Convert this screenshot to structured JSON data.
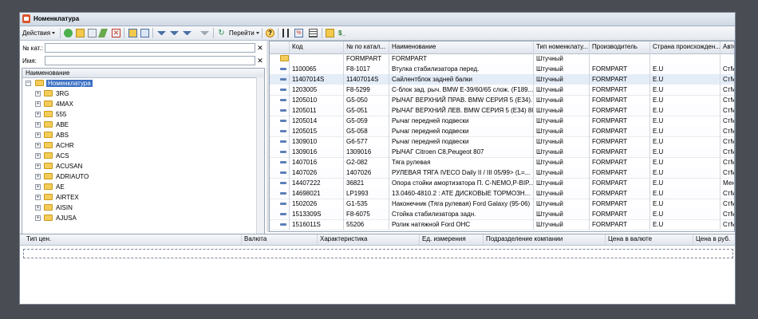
{
  "window": {
    "title": "Номенклатура"
  },
  "toolbar": {
    "actions_label": "Действия",
    "goto_label": "Перейти",
    "extra_label": "$_"
  },
  "filters": [
    {
      "label": "№ кат.:",
      "value": ""
    },
    {
      "label": "Имя:",
      "value": ""
    }
  ],
  "tree": {
    "header": "Наименование",
    "root": "Номенклатура",
    "items": [
      "3RG",
      "4MAX",
      "555",
      "ABE",
      "ABS",
      "ACHR",
      "ACS",
      "ACUSAN",
      "ADRIAUTO",
      "AE",
      "AIRTEX",
      "AISIN",
      "AJUSA"
    ]
  },
  "grid": {
    "columns": [
      "Код",
      "№ по катал...",
      "Наименование",
      "Тип номенклату...",
      "Производитель",
      "Страна происхожден...",
      "Автор"
    ],
    "rows": [
      {
        "code": "",
        "catalog": "FORMPART",
        "name": "FORMPART",
        "type": "Штучный",
        "maker": "",
        "country": "",
        "author": "",
        "folder": true
      },
      {
        "code": "1100065",
        "catalog": "F8-1017",
        "name": "Втулка стабилизатора перед.",
        "type": "Штучный",
        "maker": "FORMPART",
        "country": "E.U",
        "author": "СтМе"
      },
      {
        "code": "11407014S",
        "catalog": "11407014S",
        "name": "Сайлентблок задней балки",
        "type": "Штучный",
        "maker": "FORMPART",
        "country": "E.U",
        "author": "СтМе"
      },
      {
        "code": "1203005",
        "catalog": "F8-5299",
        "name": "С-блок зад. рыч. BMW E-39/60/65 слож. (F189...",
        "type": "Штучный",
        "maker": "FORMPART",
        "country": "E.U",
        "author": "СтМе"
      },
      {
        "code": "1205010",
        "catalog": "G5-050",
        "name": "РЫЧАГ ВЕРХНИЙ ПРАВ. BMW СЕРИЯ 5 (E34)...",
        "type": "Штучный",
        "maker": "FORMPART",
        "country": "E.U",
        "author": "СтМе"
      },
      {
        "code": "1205011",
        "catalog": "G5-051",
        "name": "РЫЧАГ ВЕРХНИЙ ЛЕВ. BMW СЕРИЯ 5 (E34) 88-...",
        "type": "Штучный",
        "maker": "FORMPART",
        "country": "E.U",
        "author": "СтМе"
      },
      {
        "code": "1205014",
        "catalog": "G5-059",
        "name": "Рычаг передней подвески",
        "type": "Штучный",
        "maker": "FORMPART",
        "country": "E.U",
        "author": "СтМе"
      },
      {
        "code": "1205015",
        "catalog": "G5-058",
        "name": "Рычаг передней подвески",
        "type": "Штучный",
        "maker": "FORMPART",
        "country": "E.U",
        "author": "СтМе"
      },
      {
        "code": "1309010",
        "catalog": "G6-577",
        "name": "Рычаг передней подвески",
        "type": "Штучный",
        "maker": "FORMPART",
        "country": "E.U",
        "author": "СтМе"
      },
      {
        "code": "1309016",
        "catalog": "1309016",
        "name": "РЫЧАГ Citroen C8,Peugeot 807",
        "type": "Штучный",
        "maker": "FORMPART",
        "country": "E.U",
        "author": "СтМе"
      },
      {
        "code": "1407016",
        "catalog": "G2-082",
        "name": "Тяга рулевая",
        "type": "Штучный",
        "maker": "FORMPART",
        "country": "E.U",
        "author": "СтМе"
      },
      {
        "code": "1407026",
        "catalog": "1407026",
        "name": "РУЛЕВАЯ ТЯГА IVECO Daily II / III 05/99> (L=...",
        "type": "Штучный",
        "maker": "FORMPART",
        "country": "E.U",
        "author": "СтМе"
      },
      {
        "code": "14407222",
        "catalog": "36821",
        "name": "Опора стойки амортизатора П. C-NEMO,P-BIP...",
        "type": "Штучный",
        "maker": "FORMPART",
        "country": "E.U",
        "author": "Мене"
      },
      {
        "code": "14698021",
        "catalog": "LP1993",
        "name": "13.0460-4810.2 : ATE ДИСКОВЫЕ ТОРМОЗН...",
        "type": "Штучный",
        "maker": "FORMPART",
        "country": "E.U",
        "author": "СтМе"
      },
      {
        "code": "1502026",
        "catalog": "G1-535",
        "name": "Наконечник (Тяга рулевая) Ford Galaxy (95-06)",
        "type": "Штучный",
        "maker": "FORMPART",
        "country": "E.U",
        "author": "СтМе"
      },
      {
        "code": "1513309S",
        "catalog": "F8-6075",
        "name": "Стойка стабилизатора задн.",
        "type": "Штучный",
        "maker": "FORMPART",
        "country": "E.U",
        "author": "СтМе"
      },
      {
        "code": "1516011S",
        "catalog": "55206",
        "name": "Ролик натяжной Ford OHC",
        "type": "Штучный",
        "maker": "FORMPART",
        "country": "E.U",
        "author": "СтМе"
      }
    ]
  },
  "prices": {
    "columns": [
      "Тип цен.",
      "Валюта",
      "Характеристика",
      "Ед. измерения",
      "Подразделение компании",
      "Цена в валюте",
      "Цена в руб."
    ]
  }
}
